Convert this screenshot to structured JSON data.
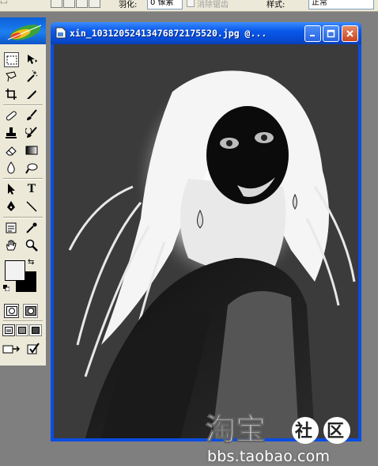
{
  "options_bar": {
    "feather_label": "羽化:",
    "feather_value": "0 像素",
    "antialias_label": "消除锯齿",
    "style_label": "样式:",
    "style_value": "正常"
  },
  "toolbox": {
    "color_fg": "#f2f2f2",
    "color_bg": "#000000",
    "tools": [
      "rect-marquee",
      "move",
      "lasso",
      "magic-wand",
      "crop",
      "slice",
      "healing-brush",
      "brush",
      "clone-stamp",
      "history-brush",
      "eraser",
      "gradient",
      "blur",
      "dodge",
      "path-select",
      "type",
      "pen",
      "line",
      "notes",
      "eyedropper",
      "hand",
      "zoom"
    ]
  },
  "document": {
    "title": "xin_10312052413476872175520.jpg @...",
    "accent": "#0a4de0"
  },
  "watermark": {
    "logo_text": "淘宝社区",
    "url": "bbs.taobao.com"
  }
}
